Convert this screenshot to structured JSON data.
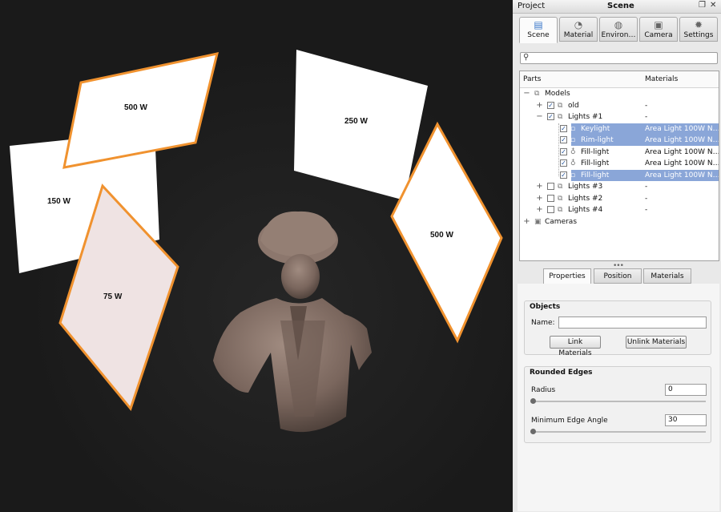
{
  "viewport": {
    "light_labels": {
      "top_left": "500 W",
      "left": "150 W",
      "bottom_left": "75 W",
      "top_right": "250 W",
      "right": "500 W"
    },
    "colors": {
      "background": "#1c1c1c",
      "panel_white": "#ffffff",
      "panel_pink": "#efe3e3",
      "highlight_orange": "#f0922f",
      "figure": "#7d6a62"
    }
  },
  "panel": {
    "title_left": "Project",
    "title_center": "Scene",
    "window_buttons": [
      "❐",
      "✕"
    ],
    "tabs": [
      {
        "label": "Scene",
        "icon": "scene-list-icon",
        "glyph": "▤"
      },
      {
        "label": "Material",
        "icon": "material-sphere-icon",
        "glyph": "◔"
      },
      {
        "label": "Environ…",
        "icon": "environment-globe-icon",
        "glyph": "◍"
      },
      {
        "label": "Camera",
        "icon": "camera-icon",
        "glyph": "▣"
      },
      {
        "label": "Settings",
        "icon": "gear-icon",
        "glyph": "✹"
      }
    ],
    "search": {
      "placeholder": "",
      "value": "",
      "icon": "search-icon",
      "glyph": "⚲"
    },
    "tree": {
      "col_parts": "Parts",
      "col_materials": "Materials",
      "rows": [
        {
          "name": "Models",
          "material": "",
          "level": 0,
          "expander": "−",
          "checkbox": null,
          "icon": "group-icon",
          "selected": false
        },
        {
          "name": "old",
          "material": "-",
          "level": 1,
          "expander": "+",
          "checkbox": true,
          "icon": "group-icon",
          "selected": false
        },
        {
          "name": "Lights #1",
          "material": "-",
          "level": 1,
          "expander": "−",
          "checkbox": true,
          "icon": "group-icon",
          "selected": false
        },
        {
          "name": "Keylight",
          "material": "Area Light 100W N…",
          "level": 2,
          "expander": "",
          "checkbox": true,
          "icon": "light-icon",
          "selected": true
        },
        {
          "name": "Rim-light",
          "material": "Area Light 100W N…",
          "level": 2,
          "expander": "",
          "checkbox": true,
          "icon": "light-icon",
          "selected": true
        },
        {
          "name": "Fill-light",
          "material": "Area Light 100W N…",
          "level": 2,
          "expander": "",
          "checkbox": true,
          "icon": "bulb-icon",
          "selected": false
        },
        {
          "name": "Fill-light",
          "material": "Area Light 100W N…",
          "level": 2,
          "expander": "",
          "checkbox": true,
          "icon": "bulb-icon",
          "selected": false
        },
        {
          "name": "Fill-light",
          "material": "Area Light 100W N…",
          "level": 2,
          "expander": "",
          "checkbox": true,
          "icon": "light-icon",
          "selected": true
        },
        {
          "name": "Lights #3",
          "material": "-",
          "level": 1,
          "expander": "+",
          "checkbox": false,
          "icon": "group-icon",
          "selected": false
        },
        {
          "name": "Lights #2",
          "material": "-",
          "level": 1,
          "expander": "+",
          "checkbox": false,
          "icon": "group-icon",
          "selected": false
        },
        {
          "name": "Lights #4",
          "material": "-",
          "level": 1,
          "expander": "+",
          "checkbox": false,
          "icon": "group-icon",
          "selected": false
        },
        {
          "name": "Cameras",
          "material": "",
          "level": 0,
          "expander": "+",
          "checkbox": null,
          "icon": "camera-icon",
          "selected": false
        }
      ]
    },
    "splitter_grip": "•••",
    "subtabs": [
      {
        "label": "Properties",
        "active": true
      },
      {
        "label": "Position",
        "active": false
      },
      {
        "label": "Materials",
        "active": false
      }
    ],
    "objects": {
      "title": "Objects",
      "name_label": "Name:",
      "name_value": "",
      "link_button": "Link Materials",
      "unlink_button": "Unlink Materials"
    },
    "rounded_edges": {
      "title": "Rounded Edges",
      "radius_label": "Radius",
      "radius_value": "0",
      "radius_level": 0,
      "angle_label": "Minimum Edge Angle",
      "angle_value": "30",
      "angle_level": 0
    }
  }
}
